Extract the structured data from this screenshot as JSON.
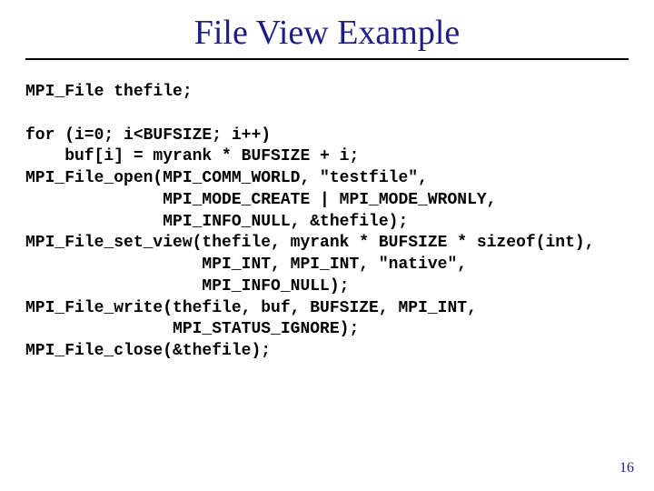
{
  "title": "File View Example",
  "code": "MPI_File thefile;\n\nfor (i=0; i<BUFSIZE; i++)\n    buf[i] = myrank * BUFSIZE + i;\nMPI_File_open(MPI_COMM_WORLD, \"testfile\",\n              MPI_MODE_CREATE | MPI_MODE_WRONLY,\n              MPI_INFO_NULL, &thefile);\nMPI_File_set_view(thefile, myrank * BUFSIZE * sizeof(int),\n                  MPI_INT, MPI_INT, \"native\",\n                  MPI_INFO_NULL);\nMPI_File_write(thefile, buf, BUFSIZE, MPI_INT,\n               MPI_STATUS_IGNORE);\nMPI_File_close(&thefile);",
  "page_number": "16"
}
